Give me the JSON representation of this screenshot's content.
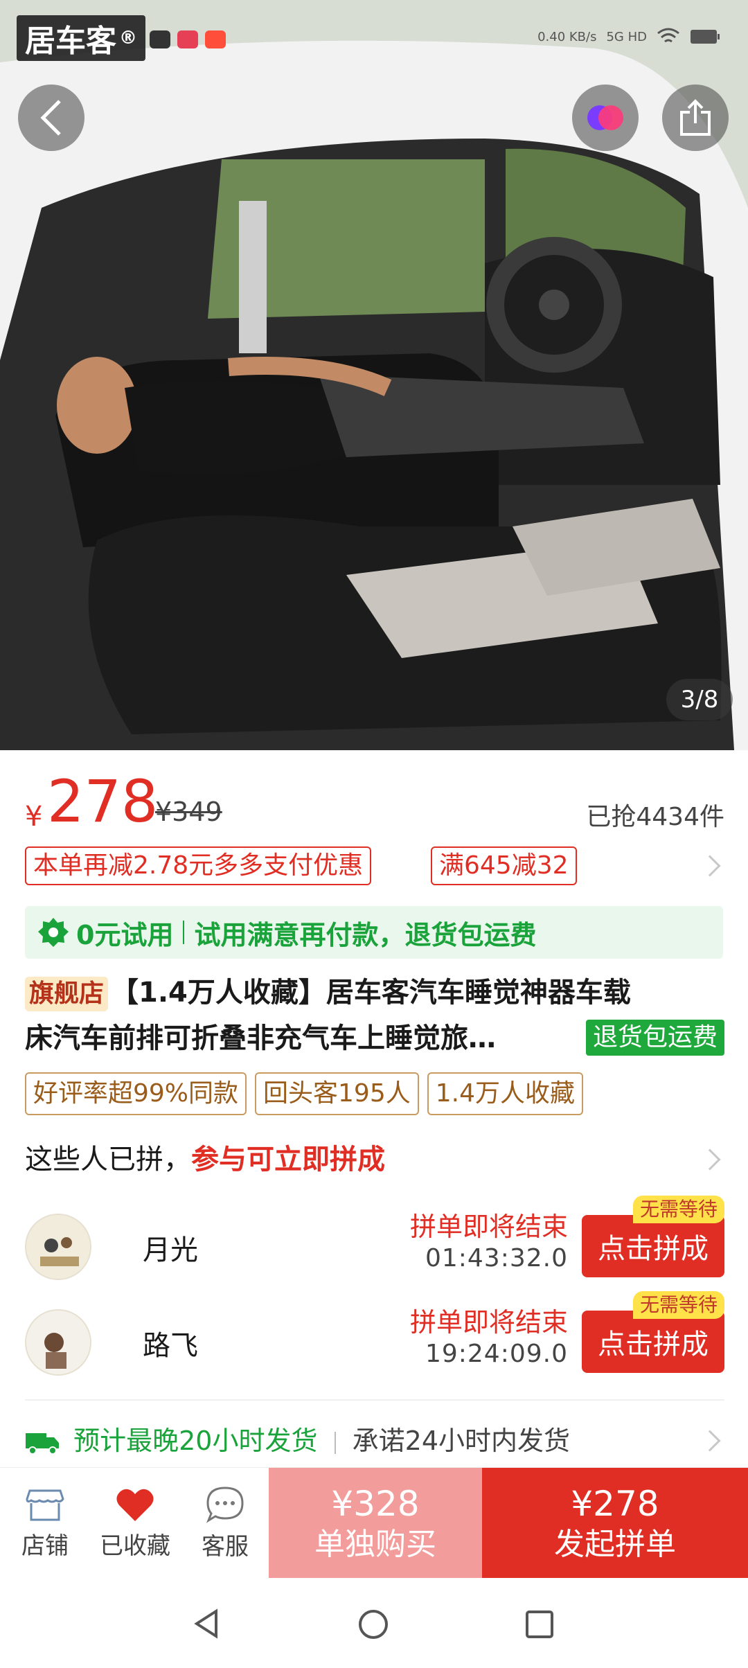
{
  "status_bar": {
    "watermark": "居车客",
    "watermark_mark": "®",
    "net_speed": "0.40 KB/s",
    "network": "5G HD"
  },
  "gallery": {
    "page_indicator": "3/8"
  },
  "price": {
    "currency": "¥",
    "current": "278",
    "original": "¥349",
    "sold": "已抢4434件"
  },
  "promos": [
    "本单再减2.78元多多支付优惠",
    "满645减32"
  ],
  "trial": {
    "label": "0元试用",
    "desc": "试用满意再付款，退货包运费"
  },
  "product": {
    "flag": "旗舰店",
    "title_line1": "【1.4万人收藏】居车客汽车睡觉神器车载",
    "title_line2": "床汽车前排可折叠非充气车上睡觉旅…",
    "return_tag": "退货包运费"
  },
  "chips": [
    "好评率超99%同款",
    "回头客195人",
    "1.4万人收藏"
  ],
  "group_buy": {
    "heading": "这些人已拼，",
    "heading_hot": "参与可立即拼成",
    "rows": [
      {
        "name": "月光",
        "status": "拼单即将结束",
        "timer": "01:43:32.0",
        "button": "点击拼成",
        "badge": "无需等待"
      },
      {
        "name": "路飞",
        "status": "拼单即将结束",
        "timer": "19:24:09.0",
        "button": "点击拼成",
        "badge": "无需等待"
      }
    ]
  },
  "shipping": {
    "primary": "预计最晚20小时发货",
    "secondary": "承诺24小时内发货"
  },
  "bottom_bar": {
    "store": "店铺",
    "favorite": "已收藏",
    "service": "客服",
    "buy_alone_price": "¥328",
    "buy_alone_label": "单独购买",
    "buy_group_price": "¥278",
    "buy_group_label": "发起拼单"
  },
  "colors": {
    "accent": "#e02e24",
    "green": "#1aa23b",
    "buy_alone_bg": "#f39c9c"
  }
}
